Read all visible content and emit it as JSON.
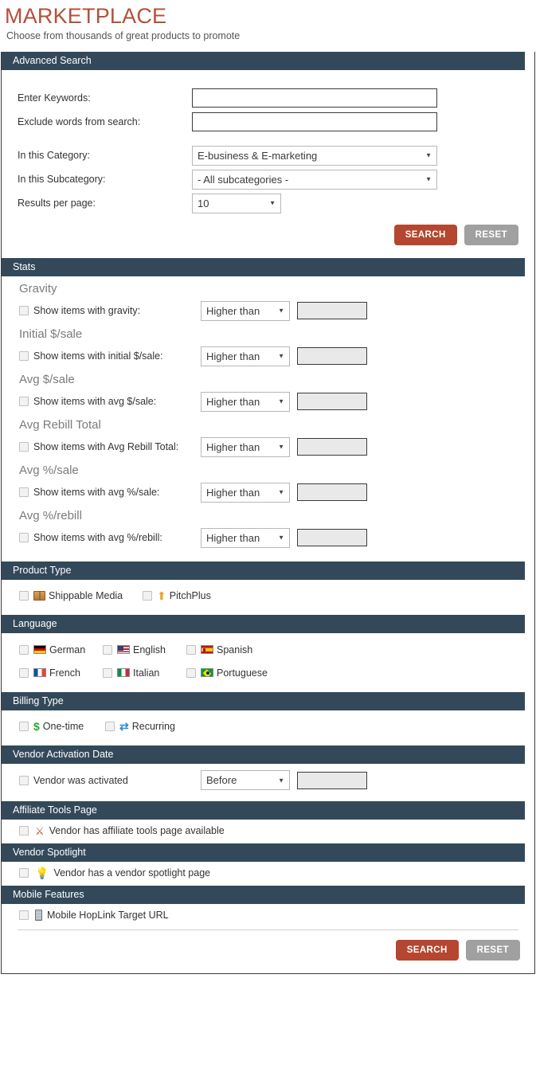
{
  "header": {
    "title": "MARKETPLACE",
    "subtitle": "Choose from thousands of great products to promote"
  },
  "sections": {
    "advanced_search": "Advanced Search",
    "stats": "Stats",
    "product_type": "Product Type",
    "language": "Language",
    "billing_type": "Billing Type",
    "vendor_activation_date": "Vendor Activation Date",
    "affiliate_tools_page": "Affiliate Tools Page",
    "vendor_spotlight": "Vendor Spotlight",
    "mobile_features": "Mobile Features"
  },
  "search_form": {
    "keywords_label": "Enter Keywords:",
    "keywords_value": "",
    "exclude_label": "Exclude words from search:",
    "exclude_value": "",
    "category_label": "In this Category:",
    "category_value": "E-business & E-marketing",
    "subcategory_label": "In this Subcategory:",
    "subcategory_value": "- All subcategories -",
    "results_label": "Results per page:",
    "results_value": "10",
    "search_button": "SEARCH",
    "reset_button": "RESET"
  },
  "stats_rows": [
    {
      "title": "Gravity",
      "label": "Show items with gravity:",
      "comparator": "Higher than",
      "value": "",
      "checked": false
    },
    {
      "title": "Initial $/sale",
      "label": "Show items with initial $/sale:",
      "comparator": "Higher than",
      "value": "",
      "checked": false
    },
    {
      "title": "Avg $/sale",
      "label": "Show items with avg $/sale:",
      "comparator": "Higher than",
      "value": "",
      "checked": false
    },
    {
      "title": "Avg Rebill Total",
      "label": "Show items with Avg Rebill Total:",
      "comparator": "Higher than",
      "value": "",
      "checked": false
    },
    {
      "title": "Avg %/sale",
      "label": "Show items with avg %/sale:",
      "comparator": "Higher than",
      "value": "",
      "checked": false
    },
    {
      "title": "Avg %/rebill",
      "label": "Show items with avg %/rebill:",
      "comparator": "Higher than",
      "value": "",
      "checked": false
    }
  ],
  "product_type": [
    {
      "label": "Shippable Media",
      "icon": "package-box-icon",
      "checked": false
    },
    {
      "label": "PitchPlus",
      "icon": "orange-up-arrow-icon",
      "checked": false
    }
  ],
  "languages": [
    {
      "label": "German",
      "icon": "flag-germany-icon",
      "checked": false
    },
    {
      "label": "English",
      "icon": "flag-usa-icon",
      "checked": false
    },
    {
      "label": "Spanish",
      "icon": "flag-spain-icon",
      "checked": false
    },
    {
      "label": "French",
      "icon": "flag-france-icon",
      "checked": false
    },
    {
      "label": "Italian",
      "icon": "flag-italy-icon",
      "checked": false
    },
    {
      "label": "Portuguese",
      "icon": "flag-brazil-icon",
      "checked": false
    }
  ],
  "billing_type": [
    {
      "label": "One-time",
      "icon": "green-dollar-icon",
      "checked": false
    },
    {
      "label": "Recurring",
      "icon": "blue-recurring-icon",
      "checked": false
    }
  ],
  "vendor_activation": {
    "label": "Vendor was activated",
    "comparator": "Before",
    "value": "",
    "checked": false
  },
  "affiliate_tools": {
    "label": "Vendor has affiliate tools page available",
    "icon": "tools-icon",
    "checked": false
  },
  "vendor_spotlight": {
    "label": "Vendor has a vendor spotlight page",
    "icon": "desk-lamp-icon",
    "checked": false
  },
  "mobile_features": {
    "label": "Mobile HopLink Target URL",
    "icon": "mobile-phone-icon",
    "checked": false
  },
  "footer": {
    "search_button": "SEARCH",
    "reset_button": "RESET"
  },
  "colors": {
    "title": "#b5503a",
    "section_header_bg": "#33495a",
    "search_button_bg": "#b5462f",
    "reset_button_bg": "#a0a0a0"
  }
}
